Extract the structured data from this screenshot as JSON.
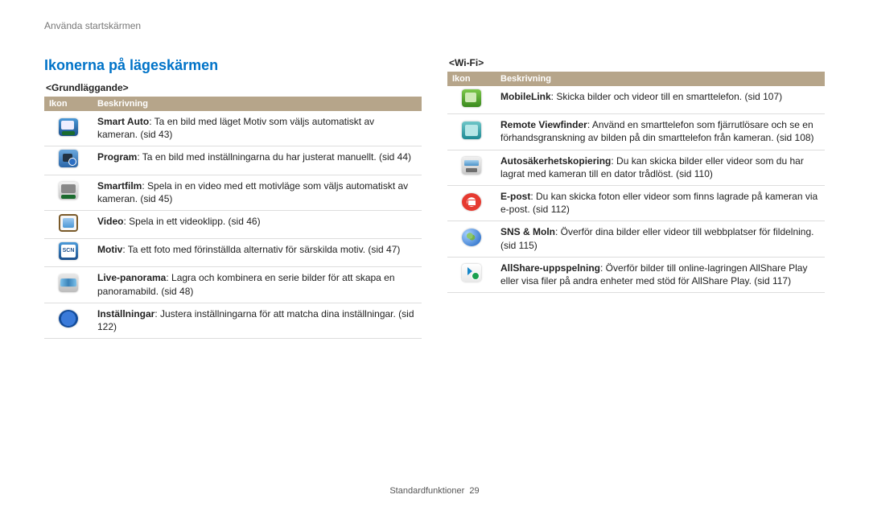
{
  "breadcrumb": "Använda startskärmen",
  "title": "Ikonerna på lägeskärmen",
  "footer": {
    "label": "Standardfunktioner",
    "page": "29"
  },
  "table_headers": {
    "icon": "Ikon",
    "desc": "Beskrivning"
  },
  "sections": {
    "basic": {
      "heading": "<Grundläggande>",
      "rows": [
        {
          "icon": "ic-smartauto",
          "name": "smart-auto-icon",
          "term": "Smart Auto",
          "desc": ": Ta en bild med läget Motiv som väljs automatiskt av kameran. (sid 43)"
        },
        {
          "icon": "ic-program",
          "name": "program-icon",
          "term": "Program",
          "desc": ": Ta en bild med inställningarna du har justerat manuellt. (sid 44)"
        },
        {
          "icon": "ic-smartfilm",
          "name": "smart-film-icon",
          "term": "Smartfilm",
          "desc": ": Spela in en video med ett motivläge som väljs automatiskt av kameran. (sid 45)"
        },
        {
          "icon": "ic-video",
          "name": "video-icon",
          "term": "Video",
          "desc": ": Spela in ett videoklipp. (sid 46)"
        },
        {
          "icon": "ic-scene",
          "name": "scene-icon",
          "term": "Motiv",
          "desc": ": Ta ett foto med förinställda alternativ för särskilda motiv. (sid 47)"
        },
        {
          "icon": "ic-panorama",
          "name": "panorama-icon",
          "term": "Live-panorama",
          "desc": ": Lagra och kombinera en serie bilder för att skapa en panoramabild. (sid 48)"
        },
        {
          "icon": "ic-settings",
          "name": "settings-icon",
          "term": "Inställningar",
          "desc": ": Justera inställningarna för att matcha dina inställningar. (sid 122)"
        }
      ]
    },
    "wifi": {
      "heading": "<Wi-Fi>",
      "rows": [
        {
          "icon": "ic-mobilelink",
          "name": "mobilelink-icon",
          "term": "MobileLink",
          "desc": ": Skicka bilder och videor till en smarttelefon. (sid 107)"
        },
        {
          "icon": "ic-remoteview",
          "name": "remote-viewfinder-icon",
          "term": "Remote Viewfinder",
          "desc": ": Använd en smarttelefon som fjärrutlösare och se en förhandsgranskning av bilden på din smarttelefon från kameran. (sid 108)"
        },
        {
          "icon": "ic-backup",
          "name": "auto-backup-icon",
          "term": "Autosäkerhetskopiering",
          "desc": ": Du kan skicka bilder eller videor som du har lagrat med kameran till en dator trådlöst. (sid 110)"
        },
        {
          "icon": "ic-email",
          "name": "email-icon",
          "term": "E-post",
          "desc": ": Du kan skicka foton eller videor som finns lagrade på kameran via e-post. (sid 112)"
        },
        {
          "icon": "ic-sns",
          "name": "sns-cloud-icon",
          "term": "SNS & Moln",
          "desc": ": Överför dina bilder eller videor till webbplatser för fildelning. (sid 115)"
        },
        {
          "icon": "ic-allshare",
          "name": "allshare-play-icon",
          "term": "AllShare-uppspelning",
          "desc": ": Överför bilder till online-lagringen AllShare Play eller visa filer på andra enheter med stöd för AllShare Play. (sid 117)"
        }
      ]
    }
  }
}
